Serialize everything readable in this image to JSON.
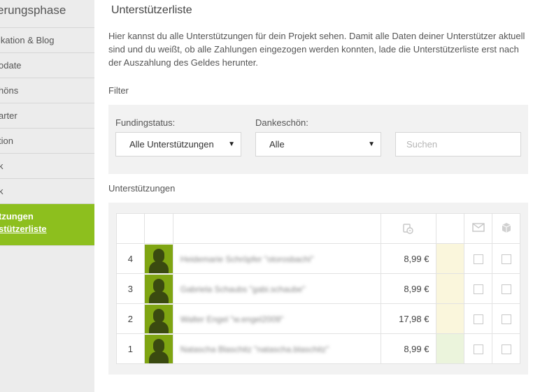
{
  "sidebar": {
    "header": "erungsphase",
    "items": [
      {
        "label": "ikation & Blog"
      },
      {
        "label": "odate"
      },
      {
        "label": "höns"
      },
      {
        "label": "arter"
      },
      {
        "label": "tion"
      },
      {
        "label": "k"
      },
      {
        "label": "k"
      }
    ],
    "active": {
      "title": "tzungen",
      "sub": "stützerliste"
    }
  },
  "main": {
    "title": "Unterstützerliste",
    "intro": "Hier kannst du alle Unterstützungen für dein Projekt sehen. Damit alle Daten deiner Unterstützer aktuell sind und du weißt, ob alle Zahlungen eingezogen werden konnten, lade die Unterstützerliste erst nach der Auszahlung des Geldes herunter.",
    "filter_heading": "Filter",
    "filter": {
      "funding_label": "Fundingstatus:",
      "funding_value": "Alle Unterstützungen",
      "thanks_label": "Dankeschön:",
      "thanks_value": "Alle",
      "search_placeholder": "Suchen"
    },
    "supporters_heading": "Unterstützungen",
    "table": {
      "rows": [
        {
          "num": "4",
          "name": "Heidemarie Schröpfer \"otorosbachi\"",
          "amount": "8,99 €",
          "status": "yellow"
        },
        {
          "num": "3",
          "name": "Gabriela Schaubs \"gabi.schaube\"",
          "amount": "8,99 €",
          "status": "yellow"
        },
        {
          "num": "2",
          "name": "Walter Engel \"w.engel2009\"",
          "amount": "17,98 €",
          "status": "yellow"
        },
        {
          "num": "1",
          "name": "Natascha Blaschitz \"natascha.blaschitz\"",
          "amount": "8,99 €",
          "status": "green"
        }
      ]
    }
  },
  "colors": {
    "accent": "#8dbf1e",
    "panel": "#f2f2f2",
    "sidebar": "#ececec"
  }
}
